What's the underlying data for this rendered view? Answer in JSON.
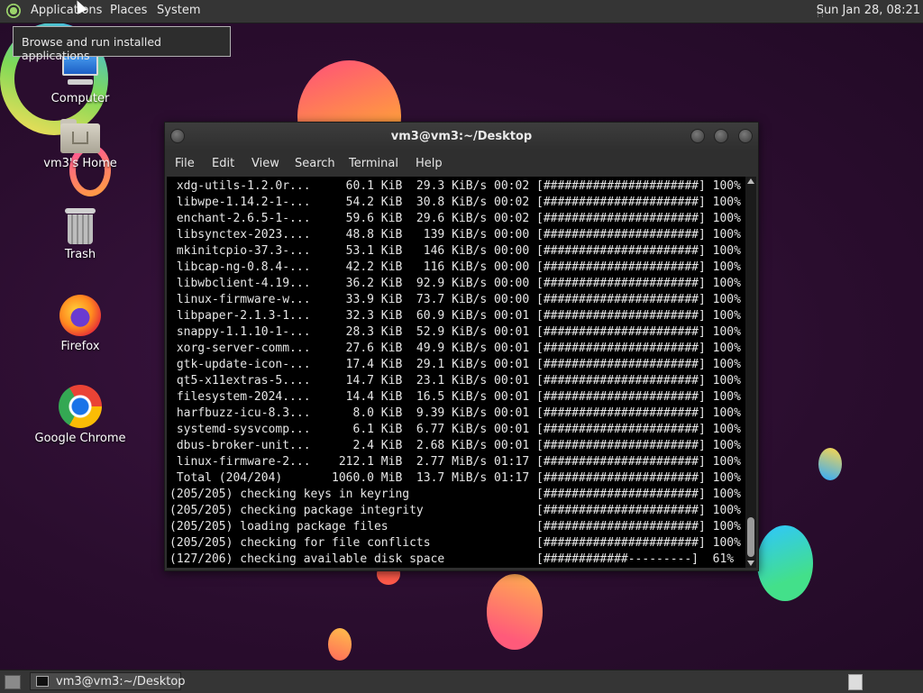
{
  "top_panel": {
    "menus": [
      "Applications",
      "Places",
      "System"
    ],
    "clock": "Sun Jan 28, 08:21",
    "tooltip": "Browse and run installed applications"
  },
  "desktop": {
    "icons": [
      {
        "label": "Computer",
        "icon": "computer-icon"
      },
      {
        "label": "vm3's Home",
        "icon": "home-folder-icon"
      },
      {
        "label": "Trash",
        "icon": "trash-icon"
      },
      {
        "label": "Firefox",
        "icon": "firefox-icon"
      },
      {
        "label": "Google Chrome",
        "icon": "chrome-icon"
      }
    ]
  },
  "terminal": {
    "title": "vm3@vm3:~/Desktop",
    "menu": [
      "File",
      "Edit",
      "View",
      "Search",
      "Terminal",
      "Help"
    ],
    "lines": [
      " xdg-utils-1.2.0r...     60.1 KiB  29.3 KiB/s 00:02 [######################] 100%",
      " libwpe-1.14.2-1-...     54.2 KiB  30.8 KiB/s 00:02 [######################] 100%",
      " enchant-2.6.5-1-...     59.6 KiB  29.6 KiB/s 00:02 [######################] 100%",
      " libsynctex-2023....     48.8 KiB   139 KiB/s 00:00 [######################] 100%",
      " mkinitcpio-37.3-...     53.1 KiB   146 KiB/s 00:00 [######################] 100%",
      " libcap-ng-0.8.4-...     42.2 KiB   116 KiB/s 00:00 [######################] 100%",
      " libwbclient-4.19...     36.2 KiB  92.9 KiB/s 00:00 [######################] 100%",
      " linux-firmware-w...     33.9 KiB  73.7 KiB/s 00:00 [######################] 100%",
      " libpaper-2.1.3-1...     32.3 KiB  60.9 KiB/s 00:01 [######################] 100%",
      " snappy-1.1.10-1-...     28.3 KiB  52.9 KiB/s 00:01 [######################] 100%",
      " xorg-server-comm...     27.6 KiB  49.9 KiB/s 00:01 [######################] 100%",
      " gtk-update-icon-...     17.4 KiB  29.1 KiB/s 00:01 [######################] 100%",
      " qt5-x11extras-5....     14.7 KiB  23.1 KiB/s 00:01 [######################] 100%",
      " filesystem-2024....     14.4 KiB  16.5 KiB/s 00:01 [######################] 100%",
      " harfbuzz-icu-8.3...      8.0 KiB  9.39 KiB/s 00:01 [######################] 100%",
      " systemd-sysvcomp...      6.1 KiB  6.77 KiB/s 00:01 [######################] 100%",
      " dbus-broker-unit...      2.4 KiB  2.68 KiB/s 00:01 [######################] 100%",
      " linux-firmware-2...    212.1 MiB  2.77 MiB/s 01:17 [######################] 100%",
      " Total (204/204)       1060.0 MiB  13.7 MiB/s 01:17 [######################] 100%",
      "(205/205) checking keys in keyring                  [######################] 100%",
      "(205/205) checking package integrity                [######################] 100%",
      "(205/205) loading package files                     [######################] 100%",
      "(205/205) checking for file conflicts               [######################] 100%",
      "(127/206) checking available disk space             [############---------]  61%"
    ]
  },
  "taskbar": {
    "task_label": "vm3@vm3:~/Desktop"
  }
}
